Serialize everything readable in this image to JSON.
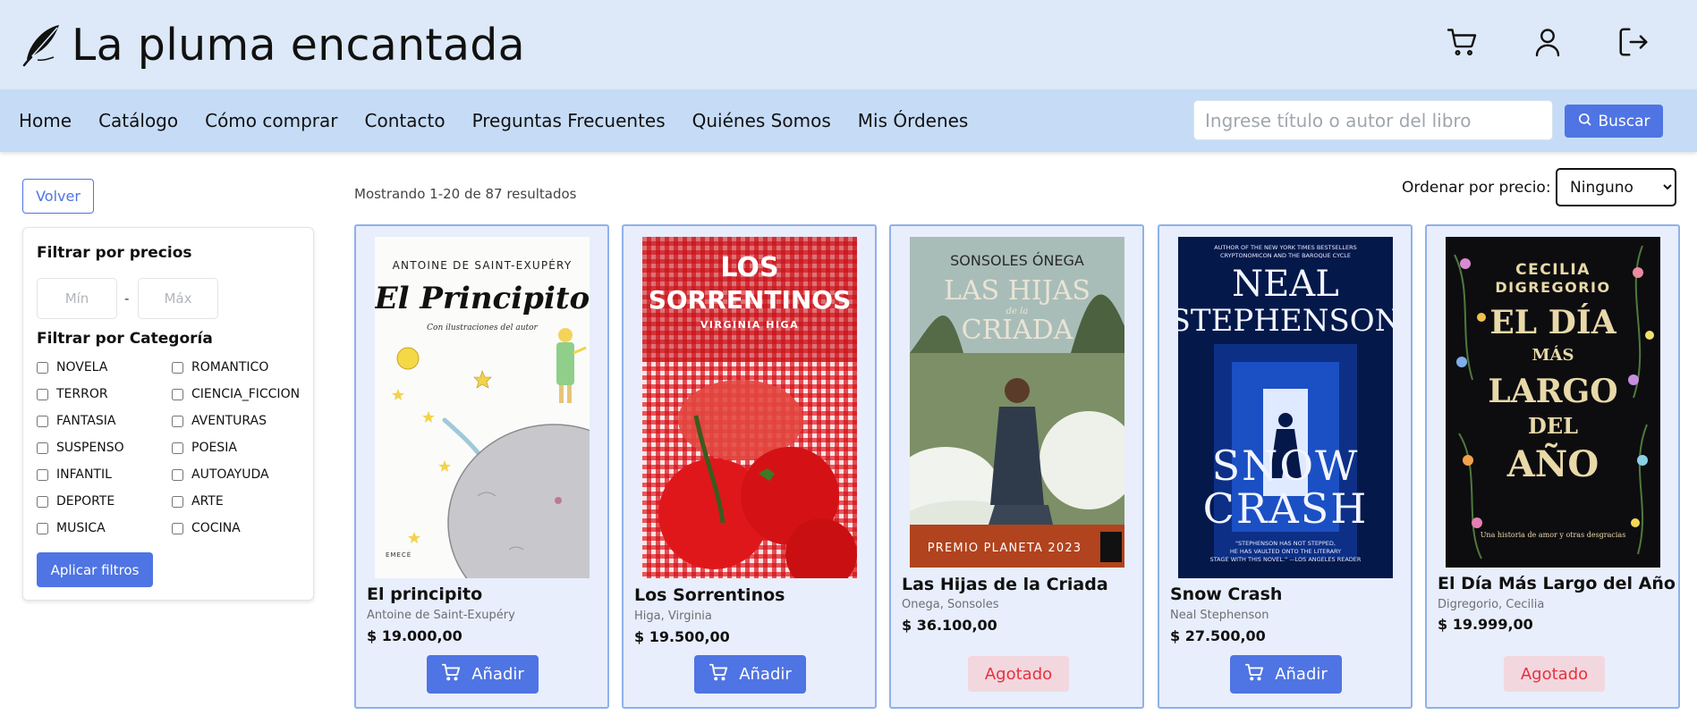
{
  "brand": {
    "title": "La pluma encantada",
    "icon": "feather-icon"
  },
  "header_icons": [
    "cart-icon",
    "user-icon",
    "logout-icon"
  ],
  "nav": {
    "links": [
      "Home",
      "Catálogo",
      "Cómo comprar",
      "Contacto",
      "Preguntas Frecuentes",
      "Quiénes Somos",
      "Mis Órdenes"
    ],
    "search_placeholder": "Ingrese título o autor del libro",
    "search_button": "Buscar"
  },
  "sidebar": {
    "back_button": "Volver",
    "price_filter_title": "Filtrar por precios",
    "min_placeholder": "Mín",
    "max_placeholder": "Máx",
    "range_separator": "-",
    "category_filter_title": "Filtrar por Categoría",
    "categories": [
      "NOVELA",
      "ROMANTICO",
      "TERROR",
      "CIENCIA_FICCION",
      "FANTASIA",
      "AVENTURAS",
      "SUSPENSO",
      "POESIA",
      "INFANTIL",
      "AUTOAYUDA",
      "DEPORTE",
      "ARTE",
      "MUSICA",
      "COCINA"
    ],
    "apply_button": "Aplicar filtros"
  },
  "results": {
    "summary": "Mostrando 1-20 de 87 resultados",
    "sort_label": "Ordenar por precio:",
    "sort_value": "Ninguno"
  },
  "books": [
    {
      "title": "El principito",
      "author": "Antoine de Saint-Exupéry",
      "price": "$ 19.000,00",
      "action": "Añadir",
      "available": true,
      "cover_lines": [
        "ANTOINE DE SAINT-EXUPÉRY",
        "El Principito",
        "Con ilustraciones del autor",
        "EMECÉ"
      ]
    },
    {
      "title": "Los Sorrentinos",
      "author": "Higa, Virginia",
      "price": "$ 19.500,00",
      "action": "Añadir",
      "available": true,
      "cover_lines": [
        "LOS",
        "SORRENTINOS",
        "VIRGINIA HIGA"
      ]
    },
    {
      "title": "Las Hijas de la Criada",
      "author": "Onega, Sonsoles",
      "price": "$ 36.100,00",
      "action": "Agotado",
      "available": false,
      "cover_lines": [
        "SONSOLES ÓNEGA",
        "LAS HIJAS",
        "de la",
        "CRIADA",
        "PREMIO PLANETA 2023"
      ]
    },
    {
      "title": "Snow Crash",
      "author": "Neal Stephenson",
      "price": "$ 27.500,00",
      "action": "Añadir",
      "available": true,
      "cover_lines": [
        "AUTHOR OF THE NEW YORK TIMES BESTSELLERS",
        "CRYPTONOMICON AND THE BAROQUE CYCLE",
        "NEAL",
        "STEPHENSON",
        "SNOW",
        "CRASH",
        "\"STEPHENSON HAS NOT STEPPED,",
        "HE HAS VAULTED ONTO THE LITERARY",
        "STAGE WITH THIS NOVEL.\" —LOS ANGELES READER"
      ]
    },
    {
      "title": "El Día Más Largo del Año",
      "author": "Digregorio, Cecilia",
      "price": "$ 19.999,00",
      "action": "Agotado",
      "available": false,
      "cover_lines": [
        "CECILIA",
        "DIGREGORIO",
        "EL DÍA",
        "MÁS",
        "LARGO",
        "DEL",
        "AÑO",
        "Una historia de amor y otras desgracias"
      ]
    }
  ],
  "colors": {
    "header_bg": "#dde9f8",
    "nav_bg": "#c6dcf6",
    "accent": "#4f74e3",
    "card_bg": "#e8eefb",
    "card_border": "#8fb1ea",
    "soldout_bg": "#f3d7df",
    "soldout_text": "#e5323d"
  }
}
